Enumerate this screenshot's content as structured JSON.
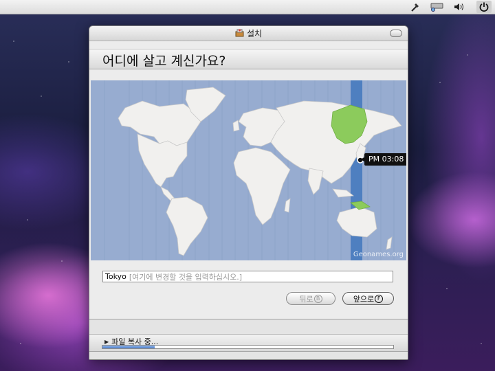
{
  "top_panel": {
    "icons": [
      "tool-icon",
      "network-icon",
      "volume-icon",
      "power-icon"
    ]
  },
  "window": {
    "title": "설치",
    "question": "어디에 살고 계신가요?"
  },
  "map": {
    "time_label": "PM 03:08",
    "attribution": "Geonames.org",
    "colors": {
      "ocean": "#97acd0",
      "land": "#f1f0ee",
      "highlight_zone": "#4e7fc0",
      "selected_region": "#8ccb5c"
    }
  },
  "location": {
    "value": "Tokyo",
    "hint": "[여기에 변경할 것을 입력하십시오.]"
  },
  "buttons": {
    "back": {
      "label": "뒤로",
      "mnemonic": "B"
    },
    "forward": {
      "label": "앞으로",
      "mnemonic": "F"
    }
  },
  "status": {
    "text": "파일 복사 중...",
    "progress": 0.18
  }
}
